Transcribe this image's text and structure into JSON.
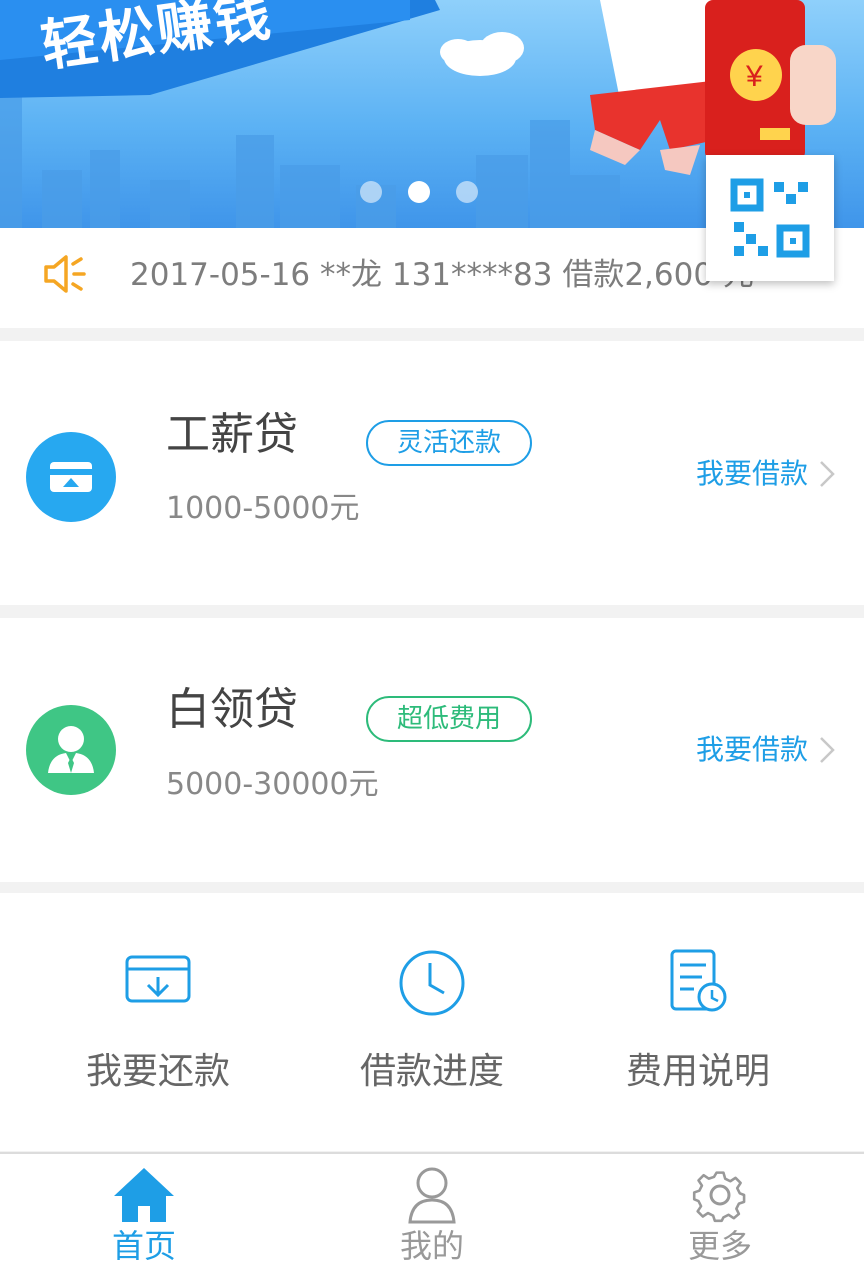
{
  "banner": {
    "title": "轻松赚钱",
    "slides": 3,
    "active_slide": 2
  },
  "notice": {
    "text": "2017-05-16 **龙 131****83 借款2,600 元"
  },
  "loans": [
    {
      "name": "工薪贷",
      "tag": "灵活还款",
      "range": "1000-5000元",
      "action": "我要借款",
      "icon": "card-upload-icon",
      "tag_color": "#1e9ee6"
    },
    {
      "name": "白领贷",
      "tag": "超低费用",
      "range": "5000-30000元",
      "action": "我要借款",
      "icon": "white-collar-person-icon",
      "tag_color": "#2dbb7a"
    }
  ],
  "features": [
    {
      "label": "我要还款",
      "icon": "repay-card-icon"
    },
    {
      "label": "借款进度",
      "icon": "clock-icon"
    },
    {
      "label": "费用说明",
      "icon": "document-clock-icon"
    }
  ],
  "tabs": [
    {
      "label": "首页",
      "icon": "home-icon",
      "active": true
    },
    {
      "label": "我的",
      "icon": "person-icon",
      "active": false
    },
    {
      "label": "更多",
      "icon": "gear-icon",
      "active": false
    }
  ],
  "colors": {
    "accent": "#1e9ee6",
    "green": "#2dbb7a",
    "notice_icon": "#f5a623"
  }
}
